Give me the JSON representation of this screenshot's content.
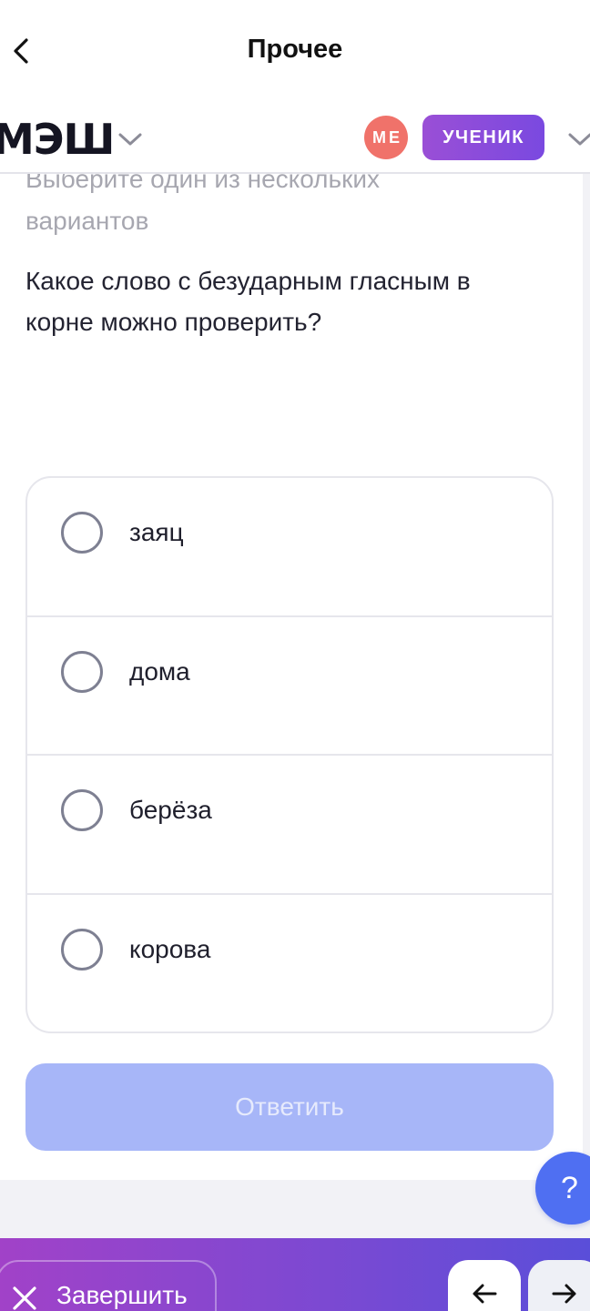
{
  "topbar": {
    "title": "Прочее"
  },
  "header": {
    "brand": "МЭШ",
    "avatar_initials": "МЕ",
    "role_badge": "УЧЕНИК"
  },
  "task": {
    "instruction": "Выберите один из нескольких вариантов",
    "question": "Какое слово с безударным гласным в корне можно проверить?",
    "options": [
      {
        "label": "заяц"
      },
      {
        "label": "дома"
      },
      {
        "label": "берёза"
      },
      {
        "label": "корова"
      }
    ],
    "submit_label": "Ответить"
  },
  "help": {
    "label": "?"
  },
  "bottombar": {
    "finish_label": "Завершить"
  },
  "colors": {
    "accent_purple": "#9a4fd6",
    "submit_disabled": "#a7b6f8",
    "help_blue": "#4f6ff2",
    "avatar_red": "#f0726a"
  },
  "icons": [
    "chevron-left-icon",
    "chevron-down-icon",
    "radio-icon",
    "close-icon",
    "arrow-left-icon",
    "arrow-right-icon"
  ]
}
